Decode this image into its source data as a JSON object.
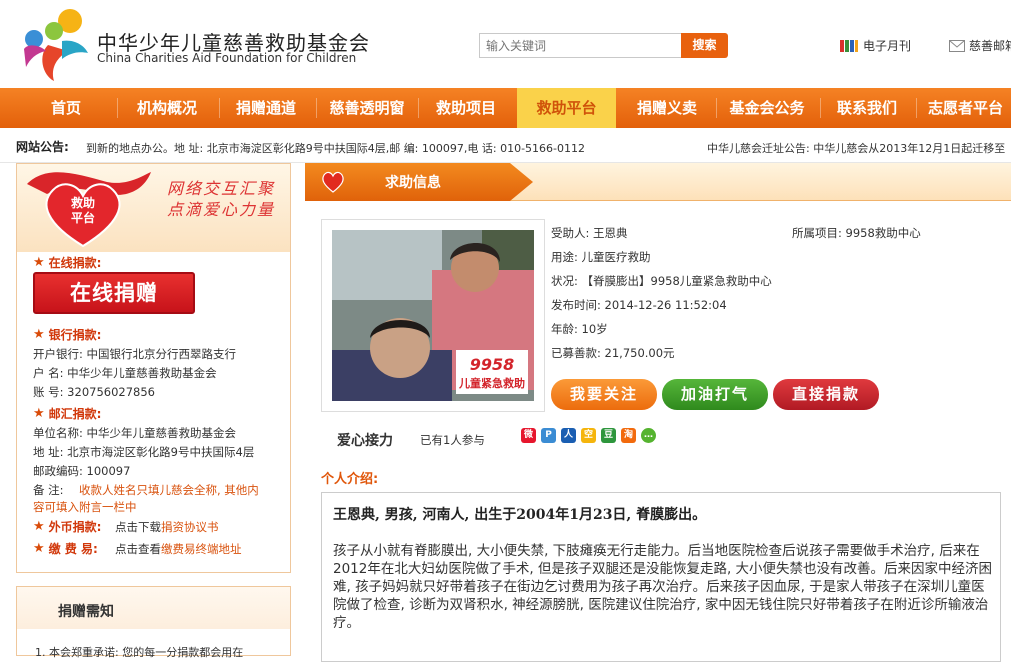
{
  "header": {
    "org_name_cn": "中华少年儿童慈善救助基金会",
    "org_name_en": "China Charities Aid Foundation for Children",
    "search_placeholder": "输入关键词",
    "search_button": "搜索",
    "links": [
      {
        "label": "电子月刊",
        "icon": "magazine-icon"
      },
      {
        "label": "慈善邮箱",
        "icon": "mail-icon"
      }
    ]
  },
  "nav": {
    "items": [
      "首页",
      "机构概况",
      "捐赠通道",
      "慈善透明窗",
      "救助项目",
      "救助平台",
      "捐赠义卖",
      "基金会公务",
      "联系我们",
      "志愿者平台"
    ],
    "active_index": 5
  },
  "notice": {
    "label": "网站公告:",
    "text1": "到新的地点办公。地 址: 北京市海淀区彰化路9号中扶国际4层,邮 编: 100097,电 话: 010-5166-0112",
    "text2": "中华儿慈会迁址公告: 中华儿慈会从2013年12月1日起迁移至"
  },
  "sidebar": {
    "badge_line1": "救助",
    "badge_line2": "平台",
    "slogan_line1": "网络交互汇聚",
    "slogan_line2": "点滴爱心力量",
    "online_title": "在线捐款:",
    "online_button": "在线捐赠",
    "bank": {
      "title": "银行捐款:",
      "lines": [
        "开户银行: 中国银行北京分行西翠路支行",
        "户 名: 中华少年儿童慈善救助基金会",
        "账 号: 320756027856"
      ]
    },
    "post": {
      "title": "邮汇捐款:",
      "lines": [
        "单位名称: 中华少年儿童慈善救助基金会",
        "地 址: 北京市海淀区彰化路9号中扶国际4层",
        "邮政编码: 100097"
      ],
      "remark_label": "备 注:",
      "remark_line1": "收款人姓名只填儿慈会全称, 其他内",
      "remark_line2": "容可填入附言一栏中"
    },
    "foreign": {
      "title": "外币捐款:",
      "prefix": "点击下载",
      "link": "捐资协议书"
    },
    "fee": {
      "title": "缴 费 易:",
      "prefix": "点击查看",
      "link": "缴费易终端地址"
    }
  },
  "need": {
    "title": "捐赠需知",
    "text": "1. 本会郑重承诺: 您的每一分捐款都会用在"
  },
  "main": {
    "tab_title": "求助信息",
    "fields": [
      {
        "label": "受助人:",
        "value": "王恩典"
      },
      {
        "label": "所属项目:",
        "value": "9958救助中心"
      },
      {
        "label": "用途:",
        "value": "儿童医疗救助"
      },
      {
        "label": "状况:",
        "value": "【脊膜膨出】9958儿童紧急救助中心"
      },
      {
        "label": "发布时间:",
        "value": "2014-12-26 11:52:04"
      },
      {
        "label": "年龄:",
        "value": "10岁"
      },
      {
        "label": "已募善款:",
        "value": "21,750.00元"
      }
    ],
    "photo_overlay_num": "9958",
    "photo_overlay_text": "儿童紧急救助",
    "buttons": {
      "follow": "我要关注",
      "cheer": "加油打气",
      "donate": "直接捐款"
    },
    "relay_title": "爱心接力",
    "relay_count": "已有1人参与",
    "share_icons": [
      "weibo-icon",
      "pinterest-icon",
      "renren-icon",
      "qzone-icon",
      "douban-icon",
      "taobao-icon",
      "wechat-icon"
    ],
    "share_glyphs": [
      "微",
      "P",
      "人",
      "空",
      "豆",
      "淘",
      "…"
    ],
    "intro_label": "个人介绍:",
    "intro_lead": "王恩典, 男孩, 河南人, 出生于2004年1月23日, 脊膜膨出。",
    "intro_body": "孩子从小就有脊膨膜出, 大小便失禁, 下肢瘫痪无行走能力。后当地医院检查后说孩子需要做手术治疗, 后来在2012年在北大妇幼医院做了手术, 但是孩子双腿还是没能恢复走路, 大小便失禁也没有改善。后来因家中经济困难, 孩子妈妈就只好带着孩子在街边乞讨费用为孩子再次治疗。后来孩子因血尿, 于是家人带孩子在深圳儿童医院做了检查, 诊断为双肾积水, 神经源膀胱, 医院建议住院治疗, 家中因无钱住院只好带着孩子在附近诊所输液治疗。"
  },
  "colors": {
    "nav_orange": "#ef7417",
    "active_yellow": "#fad24a",
    "accent_red": "#d1380b",
    "donate_red": "#c7131a"
  }
}
